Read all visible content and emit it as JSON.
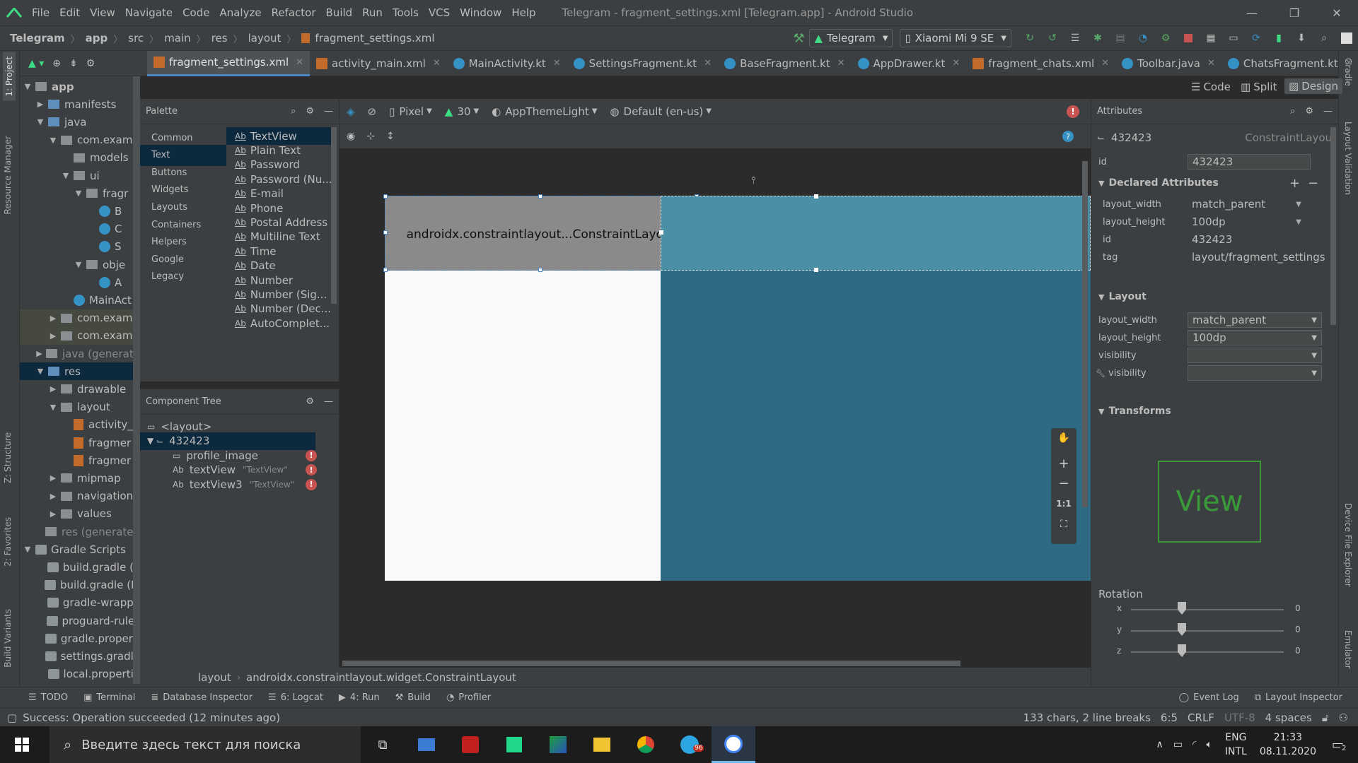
{
  "window": {
    "title": "Telegram - fragment_settings.xml [Telegram.app] - Android Studio",
    "menu": [
      "File",
      "Edit",
      "View",
      "Navigate",
      "Code",
      "Analyze",
      "Refactor",
      "Build",
      "Run",
      "Tools",
      "VCS",
      "Window",
      "Help"
    ]
  },
  "nav": {
    "crumbs": [
      "Telegram",
      "app",
      "src",
      "main",
      "res",
      "layout",
      "fragment_settings.xml"
    ],
    "run_config": "Telegram",
    "device": "Xiaomi Mi 9 SE"
  },
  "tabs": [
    "fragment_settings.xml",
    "activity_main.xml",
    "MainActivity.kt",
    "SettingsFragment.kt",
    "BaseFragment.kt",
    "AppDrawer.kt",
    "fragment_chats.xml",
    "Toolbar.java",
    "ChatsFragment.kt"
  ],
  "modes": {
    "code": "Code",
    "split": "Split",
    "design": "Design"
  },
  "project": {
    "items": [
      {
        "label": "app",
        "level": 0,
        "arrow": "▼",
        "icon": "folder",
        "bold": true
      },
      {
        "label": "manifests",
        "level": 1,
        "arrow": "▶",
        "icon": "folder-blue"
      },
      {
        "label": "java",
        "level": 1,
        "arrow": "▼",
        "icon": "folder-blue"
      },
      {
        "label": "com.examp",
        "level": 2,
        "arrow": "▼",
        "icon": "folder"
      },
      {
        "label": "models",
        "level": 3,
        "arrow": "",
        "icon": "folder"
      },
      {
        "label": "ui",
        "level": 3,
        "arrow": "▼",
        "icon": "folder"
      },
      {
        "label": "fragr",
        "level": 4,
        "arrow": "▼",
        "icon": "folder"
      },
      {
        "label": "B",
        "level": 5,
        "arrow": "",
        "icon": "java"
      },
      {
        "label": "C",
        "level": 5,
        "arrow": "",
        "icon": "java"
      },
      {
        "label": "S",
        "level": 5,
        "arrow": "",
        "icon": "java"
      },
      {
        "label": "obje",
        "level": 4,
        "arrow": "▼",
        "icon": "folder"
      },
      {
        "label": "A",
        "level": 5,
        "arrow": "",
        "icon": "java"
      },
      {
        "label": "MainAct",
        "level": 3,
        "arrow": "",
        "icon": "java"
      },
      {
        "label": "com.examp",
        "level": 2,
        "arrow": "▶",
        "icon": "folder",
        "hl": true
      },
      {
        "label": "com.examp",
        "level": 2,
        "arrow": "▶",
        "icon": "folder",
        "hl": true
      },
      {
        "label": "java (generate",
        "level": 1,
        "arrow": "▶",
        "icon": "folder",
        "dim": true
      },
      {
        "label": "res",
        "level": 1,
        "arrow": "▼",
        "icon": "folder-blue",
        "sel": true
      },
      {
        "label": "drawable",
        "level": 2,
        "arrow": "▶",
        "icon": "folder"
      },
      {
        "label": "layout",
        "level": 2,
        "arrow": "▼",
        "icon": "folder"
      },
      {
        "label": "activity_",
        "level": 3,
        "arrow": "",
        "icon": "xml"
      },
      {
        "label": "fragmer",
        "level": 3,
        "arrow": "",
        "icon": "xml"
      },
      {
        "label": "fragmer",
        "level": 3,
        "arrow": "",
        "icon": "xml"
      },
      {
        "label": "mipmap",
        "level": 2,
        "arrow": "▶",
        "icon": "folder"
      },
      {
        "label": "navigation",
        "level": 2,
        "arrow": "▶",
        "icon": "folder"
      },
      {
        "label": "values",
        "level": 2,
        "arrow": "▶",
        "icon": "folder"
      },
      {
        "label": "res (generated",
        "level": 1,
        "arrow": "",
        "icon": "folder",
        "dim": true
      },
      {
        "label": "Gradle Scripts",
        "level": 0,
        "arrow": "▼",
        "icon": "gradle"
      },
      {
        "label": "build.gradle (P",
        "level": 1,
        "arrow": "",
        "icon": "gradle"
      },
      {
        "label": "build.gradle (M",
        "level": 1,
        "arrow": "",
        "icon": "gradle"
      },
      {
        "label": "gradle-wrappe",
        "level": 1,
        "arrow": "",
        "icon": "gradle"
      },
      {
        "label": "proguard-rules",
        "level": 1,
        "arrow": "",
        "icon": "gradle"
      },
      {
        "label": "gradle.properti",
        "level": 1,
        "arrow": "",
        "icon": "gradle"
      },
      {
        "label": "settings.gradle",
        "level": 1,
        "arrow": "",
        "icon": "gradle"
      },
      {
        "label": "local.propertie",
        "level": 1,
        "arrow": "",
        "icon": "gradle"
      }
    ]
  },
  "palette": {
    "title": "Palette",
    "categories": [
      "Common",
      "Text",
      "Buttons",
      "Widgets",
      "Layouts",
      "Containers",
      "Helpers",
      "Google",
      "Legacy"
    ],
    "selected_category": "Text",
    "items": [
      "TextView",
      "Plain Text",
      "Password",
      "Password (Nu...",
      "E-mail",
      "Phone",
      "Postal Address",
      "Multiline Text",
      "Time",
      "Date",
      "Number",
      "Number (Sig...",
      "Number (Dec...",
      "AutoComplet..."
    ]
  },
  "component_tree": {
    "title": "Component Tree",
    "items": [
      {
        "label": "<layout>",
        "level": 0,
        "hint": "",
        "err": false
      },
      {
        "label": "432423",
        "level": 0,
        "hint": "",
        "err": false,
        "sel": true
      },
      {
        "label": "profile_image",
        "level": 1,
        "hint": "",
        "err": true
      },
      {
        "label": "textView",
        "level": 1,
        "hint": "\"TextView\"",
        "err": true
      },
      {
        "label": "textView3",
        "level": 1,
        "hint": "\"TextView\"",
        "err": true
      }
    ]
  },
  "design_toolbar": {
    "device": "Pixel",
    "api": "30",
    "theme": "AppThemeLight",
    "locale": "Default (en-us)"
  },
  "canvas": {
    "layout_label": "androidx.constraintlayout...ConstraintLayout"
  },
  "breadcrumb": {
    "root": "layout",
    "current": "androidx.constraintlayout.widget.ConstraintLayout"
  },
  "zoom_controls": {
    "fit": "1:1"
  },
  "attributes": {
    "title": "Attributes",
    "component_id": "432423",
    "component_class": "ConstraintLayout",
    "id_label": "id",
    "id_value": "432423",
    "declared_title": "Declared Attributes",
    "declared": [
      {
        "name": "layout_width",
        "value": "match_parent",
        "dropdown": true
      },
      {
        "name": "layout_height",
        "value": "100dp",
        "dropdown": true
      },
      {
        "name": "id",
        "value": "432423",
        "dropdown": false
      },
      {
        "name": "tag",
        "value": "layout/fragment_settings",
        "dropdown": false
      }
    ],
    "layout_title": "Layout",
    "layout": [
      {
        "name": "layout_width",
        "value": "match_parent"
      },
      {
        "name": "layout_height",
        "value": "100dp"
      },
      {
        "name": "visibility",
        "value": ""
      },
      {
        "name": "visibility",
        "value": ""
      }
    ],
    "transforms_title": "Transforms",
    "view_label": "View",
    "rotation_title": "Rotation",
    "rotation": [
      {
        "axis": "x",
        "value": "0"
      },
      {
        "axis": "y",
        "value": "0"
      },
      {
        "axis": "z",
        "value": "0"
      }
    ]
  },
  "bottom_tabs": [
    "TODO",
    "Terminal",
    "Database Inspector",
    "6: Logcat",
    "4: Run",
    "Build",
    "Profiler"
  ],
  "bottom_right_tabs": [
    "Event Log",
    "Layout Inspector"
  ],
  "side_tabs_left": [
    "1: Project",
    "Resource Manager",
    "Z: Structure",
    "2: Favorites",
    "Build Variants"
  ],
  "side_tabs_right": [
    "Gradle",
    "Layout Validation",
    "Device File Explorer",
    "Emulator"
  ],
  "status": {
    "message": "Success: Operation succeeded (12 minutes ago)",
    "chars": "133 chars, 2 line breaks",
    "position": "6:5",
    "line_sep": "CRLF",
    "encoding": "UTF-8",
    "indent": "4 spaces"
  },
  "taskbar": {
    "search_placeholder": "Введите здесь текст для поиска",
    "lang1": "ENG",
    "lang2": "INTL",
    "time": "21:33",
    "date": "08.11.2020",
    "notif_count": "2",
    "telegram_badge": "96"
  }
}
